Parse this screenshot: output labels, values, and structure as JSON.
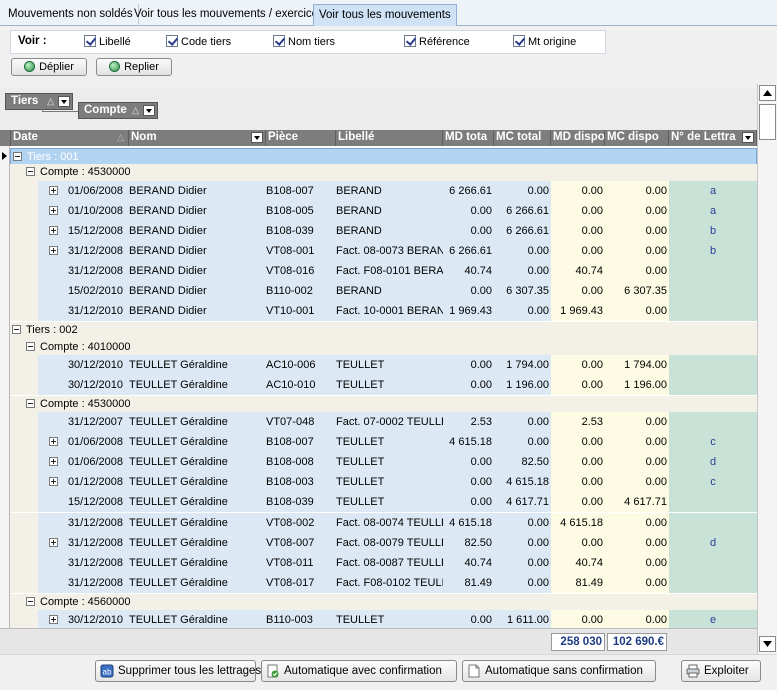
{
  "tabs": [
    {
      "label": "Mouvements non soldés"
    },
    {
      "label": "Voir tous les mouvements / exercice"
    },
    {
      "label": "Voir tous les mouvements",
      "active": true
    }
  ],
  "voir": {
    "label": "Voir :",
    "options": [
      {
        "label": "Libellé",
        "checked": true
      },
      {
        "label": "Code tiers",
        "checked": true
      },
      {
        "label": "Nom tiers",
        "checked": true
      },
      {
        "label": "Référence",
        "checked": true
      },
      {
        "label": "Mt origine",
        "checked": true
      }
    ]
  },
  "buttons": {
    "deplier": "Déplier",
    "replier": "Replier"
  },
  "grouping": {
    "tiers": "Tiers",
    "compte": "Compte"
  },
  "columns": [
    "Date",
    "Nom",
    "Pièce",
    "Libellé",
    "MD tota",
    "MC total",
    "MD dispo",
    "MC dispo",
    "N° de Lettra"
  ],
  "groups": {
    "t1": "Tiers : 001",
    "c1": "Compte : 4530000",
    "t2": "Tiers : 002",
    "c2": "Compte : 4010000",
    "c3": "Compte : 4530000",
    "c4": "Compte : 4560000"
  },
  "rows": {
    "r1": {
      "date": "01/06/2008",
      "nom": "BERAND Didier",
      "piece": "B108-007",
      "libelle": "BERAND",
      "md": "6 266.61",
      "mc": "0.00",
      "mdd": "0.00",
      "mcd": "0.00",
      "let": "a"
    },
    "r2": {
      "date": "01/10/2008",
      "nom": "BERAND Didier",
      "piece": "B108-005",
      "libelle": "BERAND",
      "md": "0.00",
      "mc": "6 266.61",
      "mdd": "0.00",
      "mcd": "0.00",
      "let": "a"
    },
    "r3": {
      "date": "15/12/2008",
      "nom": "BERAND Didier",
      "piece": "B108-039",
      "libelle": "BERAND",
      "md": "0.00",
      "mc": "6 266.61",
      "mdd": "0.00",
      "mcd": "0.00",
      "let": "b"
    },
    "r4": {
      "date": "31/12/2008",
      "nom": "BERAND Didier",
      "piece": "VT08-001",
      "libelle": "Fact. 08-0073 BERAN",
      "md": "6 266.61",
      "mc": "0.00",
      "mdd": "0.00",
      "mcd": "0.00",
      "let": "b"
    },
    "r5": {
      "date": "31/12/2008",
      "nom": "BERAND Didier",
      "piece": "VT08-016",
      "libelle": "Fact. F08-0101 BERA",
      "md": "40.74",
      "mc": "0.00",
      "mdd": "40.74",
      "mcd": "0.00",
      "let": ""
    },
    "r6": {
      "date": "15/02/2010",
      "nom": "BERAND Didier",
      "piece": "B110-002",
      "libelle": "BERAND",
      "md": "0.00",
      "mc": "6 307.35",
      "mdd": "0.00",
      "mcd": "6 307.35",
      "let": ""
    },
    "r7": {
      "date": "31/12/2010",
      "nom": "BERAND Didier",
      "piece": "VT10-001",
      "libelle": "Fact. 10-0001 BERAN",
      "md": "1 969.43",
      "mc": "0.00",
      "mdd": "1 969.43",
      "mcd": "0.00",
      "let": ""
    },
    "r8": {
      "date": "30/12/2010",
      "nom": "TEULLET Géraldine",
      "piece": "AC10-006",
      "libelle": "TEULLET",
      "md": "0.00",
      "mc": "1 794.00",
      "mdd": "0.00",
      "mcd": "1 794.00",
      "let": ""
    },
    "r9": {
      "date": "30/12/2010",
      "nom": "TEULLET Géraldine",
      "piece": "AC10-010",
      "libelle": "TEULLET",
      "md": "0.00",
      "mc": "1 196.00",
      "mdd": "0.00",
      "mcd": "1 196.00",
      "let": ""
    },
    "r10": {
      "date": "31/12/2007",
      "nom": "TEULLET Géraldine",
      "piece": "VT07-048",
      "libelle": "Fact. 07-0002 TEULLE",
      "md": "2.53",
      "mc": "0.00",
      "mdd": "2.53",
      "mcd": "0.00",
      "let": ""
    },
    "r11": {
      "date": "01/06/2008",
      "nom": "TEULLET Géraldine",
      "piece": "B108-007",
      "libelle": "TEULLET",
      "md": "4 615.18",
      "mc": "0.00",
      "mdd": "0.00",
      "mcd": "0.00",
      "let": "c"
    },
    "r12": {
      "date": "01/06/2008",
      "nom": "TEULLET Géraldine",
      "piece": "B108-008",
      "libelle": "TEULLET",
      "md": "0.00",
      "mc": "82.50",
      "mdd": "0.00",
      "mcd": "0.00",
      "let": "d"
    },
    "r13": {
      "date": "01/12/2008",
      "nom": "TEULLET Géraldine",
      "piece": "B108-003",
      "libelle": "TEULLET",
      "md": "0.00",
      "mc": "4 615.18",
      "mdd": "0.00",
      "mcd": "0.00",
      "let": "c"
    },
    "r14": {
      "date": "15/12/2008",
      "nom": "TEULLET Géraldine",
      "piece": "B108-039",
      "libelle": "TEULLET",
      "md": "0.00",
      "mc": "4 617.71",
      "mdd": "0.00",
      "mcd": "4 617.71",
      "let": ""
    },
    "r15": {
      "date": "31/12/2008",
      "nom": "TEULLET Géraldine",
      "piece": "VT08-002",
      "libelle": "Fact. 08-0074 TEULLE",
      "md": "4 615.18",
      "mc": "0.00",
      "mdd": "4 615.18",
      "mcd": "0.00",
      "let": ""
    },
    "r16": {
      "date": "31/12/2008",
      "nom": "TEULLET Géraldine",
      "piece": "VT08-007",
      "libelle": "Fact. 08-0079 TEULLE",
      "md": "82.50",
      "mc": "0.00",
      "mdd": "0.00",
      "mcd": "0.00",
      "let": "d"
    },
    "r17": {
      "date": "31/12/2008",
      "nom": "TEULLET Géraldine",
      "piece": "VT08-011",
      "libelle": "Fact. 08-0087 TEULLE",
      "md": "40.74",
      "mc": "0.00",
      "mdd": "40.74",
      "mcd": "0.00",
      "let": ""
    },
    "r18": {
      "date": "31/12/2008",
      "nom": "TEULLET Géraldine",
      "piece": "VT08-017",
      "libelle": "Fact. F08-0102 TEULL",
      "md": "81.49",
      "mc": "0.00",
      "mdd": "81.49",
      "mcd": "0.00",
      "let": ""
    },
    "r19": {
      "date": "30/12/2010",
      "nom": "TEULLET Géraldine",
      "piece": "B110-003",
      "libelle": "TEULLET",
      "md": "0.00",
      "mc": "1 611.00",
      "mdd": "0.00",
      "mcd": "0.00",
      "let": "e"
    }
  },
  "totals": {
    "md_dispo": "258 030",
    "mc_dispo": "102 690.€"
  },
  "bottom": {
    "supprimer": "Supprimer tous les lettrages",
    "auto_conf": "Automatique avec confirmation",
    "auto_sans": "Automatique sans confirmation",
    "exploiter": "Exploiter"
  }
}
